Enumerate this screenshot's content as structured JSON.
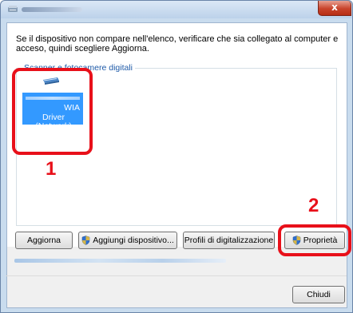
{
  "window": {
    "close_glyph": "x"
  },
  "instruction_text": "Se il dispositivo non compare nell'elenco, verificare che sia collegato al computer e acceso, quindi scegliere Aggiorna.",
  "device_group": {
    "legend": "Scanner e fotocamere digitali"
  },
  "device": {
    "name_line1": "WIA",
    "name_line2": "Driver (Network)",
    "icon": "scanner-icon"
  },
  "buttons": {
    "refresh": "Aggiorna",
    "add_device": "Aggiungi dispositivo...",
    "scan_profiles": "Profili di digitalizzazione",
    "properties": "Proprietà",
    "close": "Chiudi"
  },
  "callouts": {
    "first": "1",
    "second": "2"
  },
  "colors": {
    "highlight": "#e8101a",
    "selection": "#3399ff",
    "group_legend": "#1e5aa8"
  }
}
